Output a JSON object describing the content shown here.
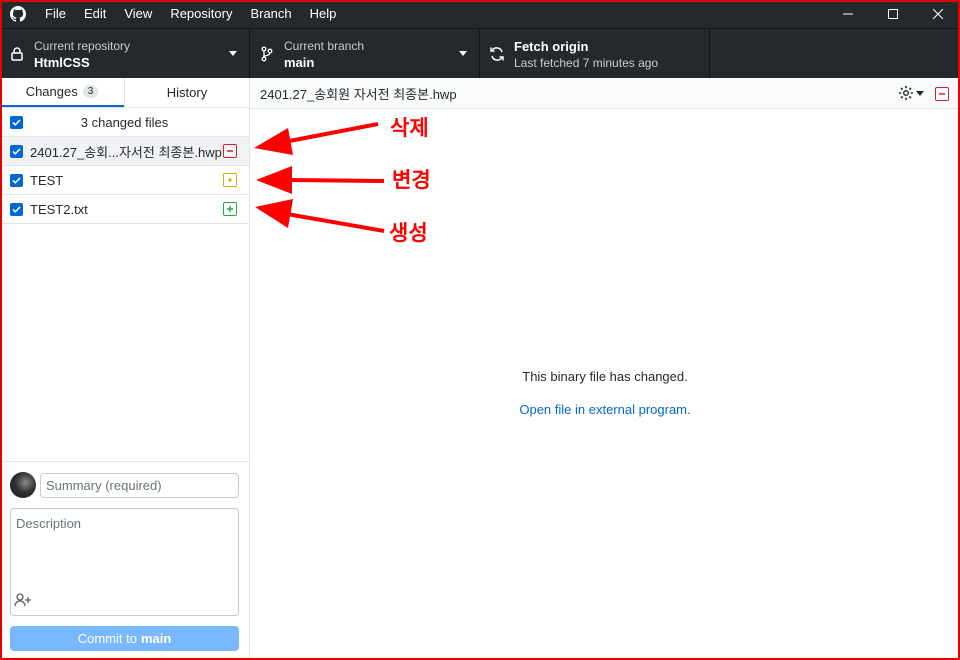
{
  "menu": [
    "File",
    "Edit",
    "View",
    "Repository",
    "Branch",
    "Help"
  ],
  "toolbar": {
    "repo_label": "Current repository",
    "repo_value": "HtmlCSS",
    "branch_label": "Current branch",
    "branch_value": "main",
    "fetch_label": "Fetch origin",
    "fetch_sub": "Last fetched 7 minutes ago"
  },
  "tabs": {
    "changes": "Changes",
    "changes_count": "3",
    "history": "History"
  },
  "changes": {
    "header": "3 changed files",
    "files": [
      {
        "name": "2401.27_송회...자서전 최종본.hwp",
        "status": "deleted"
      },
      {
        "name": "TEST",
        "status": "modified"
      },
      {
        "name": "TEST2.txt",
        "status": "added"
      }
    ]
  },
  "commit": {
    "summary_placeholder": "Summary (required)",
    "description_placeholder": "Description",
    "button_prefix": "Commit to",
    "button_branch": "main"
  },
  "diff": {
    "file_path": "2401.27_송회원 자서전 최종본.hwp",
    "message": "This binary file has changed.",
    "link": "Open file in external program."
  },
  "annotations": {
    "deleted": "삭제",
    "modified": "변경",
    "added": "생성"
  },
  "colors": {
    "deleted": "#cb2431",
    "modified": "#dbab09",
    "added": "#28a745",
    "accent": "#0366d6",
    "annotation": "#ff0000"
  }
}
